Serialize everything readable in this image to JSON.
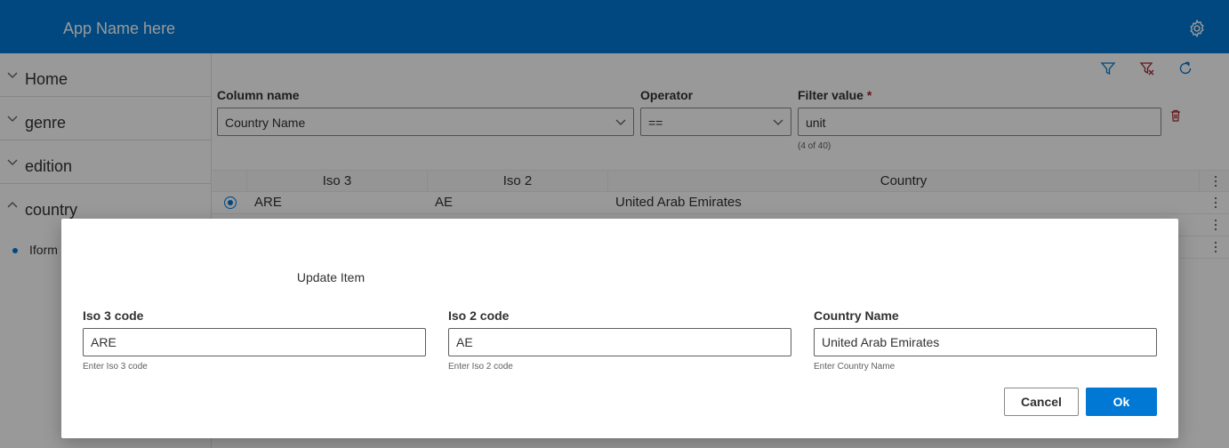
{
  "header": {
    "app_title": "App Name here",
    "settings_icon": "gear-icon",
    "brand_color": "#0078d4"
  },
  "sidebar": {
    "items": [
      {
        "label": "Home",
        "expanded": false
      },
      {
        "label": "genre",
        "expanded": false
      },
      {
        "label": "edition",
        "expanded": false
      },
      {
        "label": "country",
        "expanded": true
      }
    ],
    "sub_items": [
      {
        "label": "Iform"
      }
    ]
  },
  "toolbar": {
    "icons": [
      "filter-icon",
      "clear-filter-icon",
      "refresh-icon"
    ]
  },
  "filter": {
    "column_label": "Column name",
    "column_value": "Country Name",
    "operator_label": "Operator",
    "operator_value": "==",
    "value_label": "Filter value",
    "value_required_mark": "*",
    "value": "unit",
    "count": "(4 of 40)"
  },
  "grid": {
    "columns": [
      "Iso 3",
      "Iso 2",
      "Country"
    ],
    "rows": [
      {
        "iso3": "ARE",
        "iso2": "AE",
        "country": "United Arab Emirates",
        "selected": true
      }
    ]
  },
  "dialog": {
    "title": "Update Item",
    "fields": [
      {
        "label": "Iso 3 code",
        "value": "ARE",
        "hint": "Enter Iso 3 code"
      },
      {
        "label": "Iso 2 code",
        "value": "AE",
        "hint": "Enter Iso 2 code"
      },
      {
        "label": "Country Name",
        "value": "United Arab Emirates",
        "hint": "Enter Country Name"
      }
    ],
    "cancel_label": "Cancel",
    "ok_label": "Ok"
  }
}
